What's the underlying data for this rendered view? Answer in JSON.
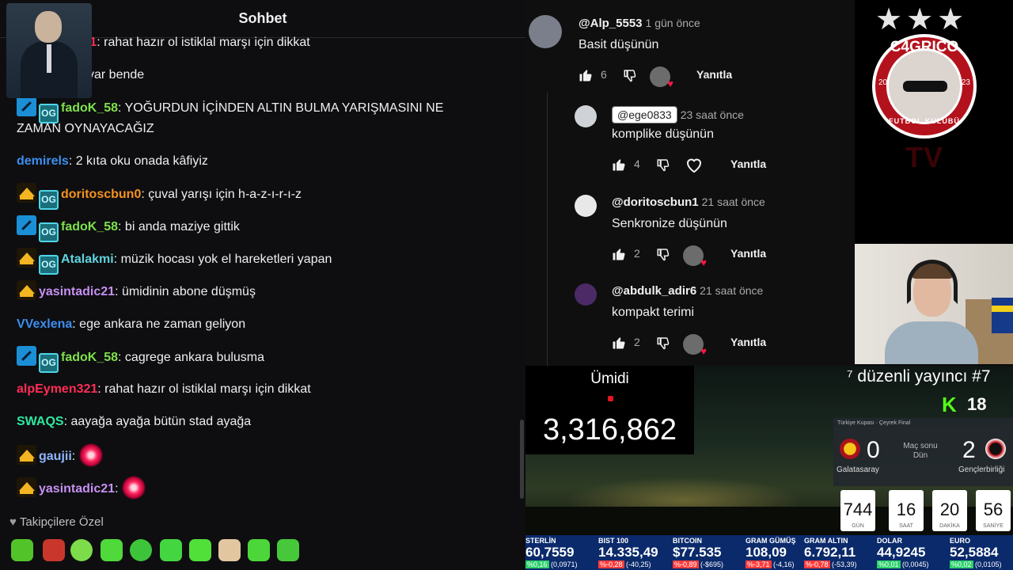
{
  "chat": {
    "title": "Sohbet",
    "messages": [
      {
        "user": "alpEymen321",
        "color": "#ff2d55",
        "badges": [],
        "text": ": rahat hazır ol istiklal marşı için dikkat"
      },
      {
        "user": "",
        "color": "#ffffff",
        "badges": [],
        "text": "var bende"
      },
      {
        "user": "fadoK_58",
        "color": "#7ee04c",
        "badges": [
          "sword",
          "og"
        ],
        "text": ": YOĞURDUN İÇİNDEN ALTIN BULMA YARIŞMASINI NE",
        "text2": "ZAMAN OYNAYACAĞIZ"
      },
      {
        "user": "demirels",
        "color": "#3c8ff0",
        "badges": [],
        "text": ": 2 kıta oku onada kâfiyiz"
      },
      {
        "user": "doritoscbun0",
        "color": "#f5921e",
        "badges": [
          "crown",
          "og"
        ],
        "text": ": çuval yarışı için h-a-z-ı-r-ı-z"
      },
      {
        "user": "fadoK_58",
        "color": "#7ee04c",
        "badges": [
          "sword",
          "og"
        ],
        "text": ": bi anda maziye gittik"
      },
      {
        "user": "Atalakmi",
        "color": "#5fd4e0",
        "badges": [
          "crown",
          "og"
        ],
        "text": ": müzik hocası yok el hareketleri yapan"
      },
      {
        "user": "yasintadic21",
        "color": "#c691f2",
        "badges": [
          "crown"
        ],
        "text": ": ümidinin abone düşmüş"
      },
      {
        "user": "VVexlena",
        "color": "#3c8ff0",
        "badges": [],
        "text": ": ege ankara ne zaman geliyon"
      },
      {
        "user": "fadoK_58",
        "color": "#7ee04c",
        "badges": [
          "sword",
          "og"
        ],
        "text": ": cagrege ankara bulusma"
      },
      {
        "user": "alpEymen321",
        "color": "#ff2d55",
        "badges": [],
        "text": ": rahat hazır ol istiklal marşı için dikkat"
      },
      {
        "user": "SWAQS",
        "color": "#2ee8a0",
        "badges": [],
        "text": ": aayağa ayağa bütün stad ayağa"
      },
      {
        "user": "gaujii",
        "color": "#8fb6ff",
        "badges": [
          "crown"
        ],
        "text": ":",
        "emote": true
      },
      {
        "user": "yasintadic21",
        "color": "#c691f2",
        "badges": [
          "crown"
        ],
        "text": ":",
        "emote": true
      }
    ],
    "og_badge_text": "OG",
    "follower_only": "Takipçilere Özel",
    "heart_glyph": "♥"
  },
  "comments": [
    {
      "user": "@Alp_5553",
      "time": "1 gün önce",
      "text": "Basit düşünün",
      "likes": "6",
      "reply": "Yanıtla",
      "tag": false
    },
    {
      "user": "@ege0833",
      "time": "23 saat önce",
      "text": "komplike düşünün",
      "likes": "4",
      "reply": "Yanıtla",
      "tag": true
    },
    {
      "user": "@doritoscbun1",
      "time": "21 saat önce",
      "text": "Senkronize düşünün",
      "likes": "2",
      "reply": "Yanıtla",
      "tag": false
    },
    {
      "user": "@abdulk_adir6",
      "time": "21 saat önce",
      "text": "kompakt terimi",
      "likes": "2",
      "reply": "Yanıtla",
      "tag": false
    }
  ],
  "brand": {
    "stars": "★★★",
    "logo_top": "C4GRICO",
    "logo_bottom": "FUTBOL KULÜBÜ",
    "year_left": "20",
    "year_right": "23",
    "tv": "TV"
  },
  "counter": {
    "label": "Ümidi",
    "value": "3,316,862"
  },
  "stream": {
    "title": "⁷ düzenli yayıncı #7",
    "kick_logo": "K",
    "kick_count": "18"
  },
  "score": {
    "header": "Türkiye Kupası · Çeyrek Final",
    "home": "Galatasaray",
    "home_score": "0",
    "away": "Gençlerbirliği",
    "away_score": "2",
    "status_line1": "Maç sonu",
    "status_line2": "Dün"
  },
  "countdown": [
    {
      "value": "744",
      "label": "GÜN"
    },
    {
      "value": "16",
      "label": "SAAT"
    },
    {
      "value": "20",
      "label": "DAKİKA"
    },
    {
      "value": "56",
      "label": "SANİYE"
    }
  ],
  "market": [
    {
      "name": "STERLİN",
      "value": "60,7559",
      "chg1": "%0,16",
      "chg2": "(0,0971)",
      "up": true
    },
    {
      "name": "BIST 100",
      "value": "14.335,49",
      "chg1": "%-0,28",
      "chg2": "(-40,25)",
      "up": false
    },
    {
      "name": "BITCOIN",
      "value": "$77.535",
      "chg1": "%-0,89",
      "chg2": "(-$695)",
      "up": false
    },
    {
      "name": "GRAM GÜMÜŞ",
      "value": "108,09",
      "chg1": "%-3,71",
      "chg2": "(-4,16)",
      "up": false
    },
    {
      "name": "GRAM ALTIN",
      "value": "6.792,11",
      "chg1": "%-0,78",
      "chg2": "(-53,39)",
      "up": false
    },
    {
      "name": "DOLAR",
      "value": "44,9245",
      "chg1": "%0,01",
      "chg2": "(0,0045)",
      "up": true
    },
    {
      "name": "EURO",
      "value": "52,5884",
      "chg1": "%0,02",
      "chg2": "(0,0105)",
      "up": true
    }
  ],
  "colors": {
    "up": "#2bd16b",
    "down": "#ff3b3b",
    "kick": "#53fc18"
  }
}
